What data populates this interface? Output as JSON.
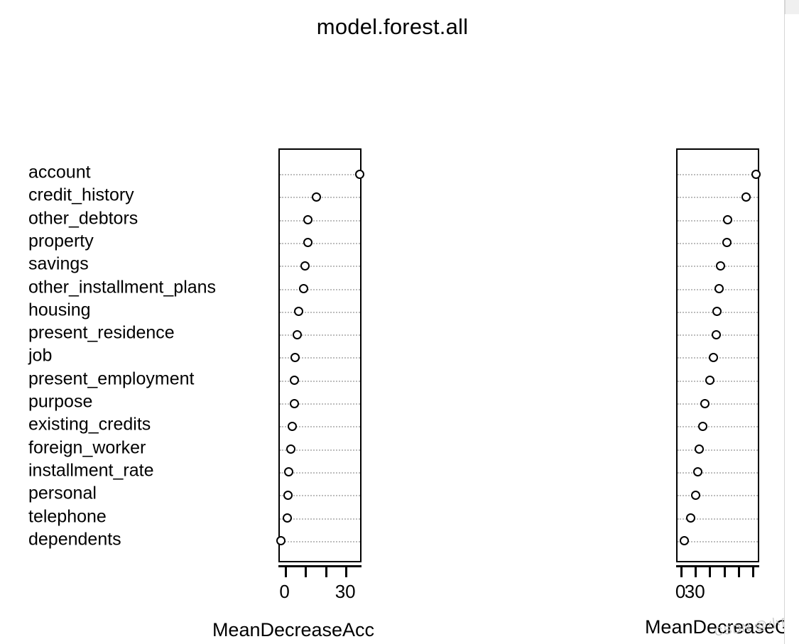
{
  "title": "model.forest.all",
  "watermark": "CSDN @小白",
  "chart_data": [
    {
      "type": "scatter",
      "title": "model.forest.all",
      "panel_name": "MeanDecreaseAccuracy",
      "xlabel": "MeanDecreaseAcc",
      "ylabel": "",
      "grid": true,
      "legend": "none",
      "xlim": [
        -3,
        38
      ],
      "xticks": [
        0,
        10,
        20,
        30
      ],
      "xtick_labels": [
        "0",
        "",
        "",
        "30"
      ],
      "categories": [
        "account",
        "credit_history",
        "other_debtors",
        "property",
        "savings",
        "other_installment_plans",
        "housing",
        "present_residence",
        "job",
        "present_employment",
        "purpose",
        "existing_credits",
        "foreign_worker",
        "installment_rate",
        "personal",
        "telephone",
        "dependents"
      ],
      "values": [
        36.5,
        15.0,
        10.7,
        10.7,
        9.6,
        8.9,
        6.4,
        5.7,
        4.6,
        4.3,
        4.3,
        3.2,
        2.5,
        1.4,
        1.1,
        0.7,
        -2.5
      ]
    },
    {
      "type": "scatter",
      "title": "model.forest.all",
      "panel_name": "MeanDecreaseGini",
      "xlabel": "MeanDecreaseG",
      "ylabel": "",
      "grid": true,
      "legend": "none",
      "xlim": [
        -3,
        55
      ],
      "xticks": [
        0,
        10,
        20,
        30,
        40,
        50
      ],
      "xtick_labels": [
        "0",
        "30",
        "",
        "",
        "",
        ""
      ],
      "categories": [
        "account",
        "purpose",
        "present_employment",
        "credit_history",
        "property",
        "present_residence",
        "savings",
        "installment_rate",
        "personal",
        "job",
        "other_installment_plans",
        "housing",
        "existing_credits",
        "other_debtors",
        "telephone",
        "dependents",
        "foreign_worker"
      ],
      "values": [
        52.0,
        45.0,
        32.0,
        31.5,
        27.0,
        26.0,
        24.5,
        24.0,
        22.0,
        19.5,
        16.0,
        14.5,
        12.0,
        11.0,
        9.5,
        6.0,
        1.5
      ]
    }
  ],
  "panels": [
    {
      "id": "acc",
      "axis_title": "MeanDecreaseAcc",
      "tick_labels": [
        {
          "text": "0",
          "value": 0
        },
        {
          "text": "30",
          "value": 30
        }
      ]
    },
    {
      "id": "gini",
      "axis_title": "MeanDecreaseG",
      "tick_labels": [
        {
          "text": "0",
          "value": 0
        },
        {
          "text": "30",
          "value": 30
        }
      ]
    }
  ]
}
